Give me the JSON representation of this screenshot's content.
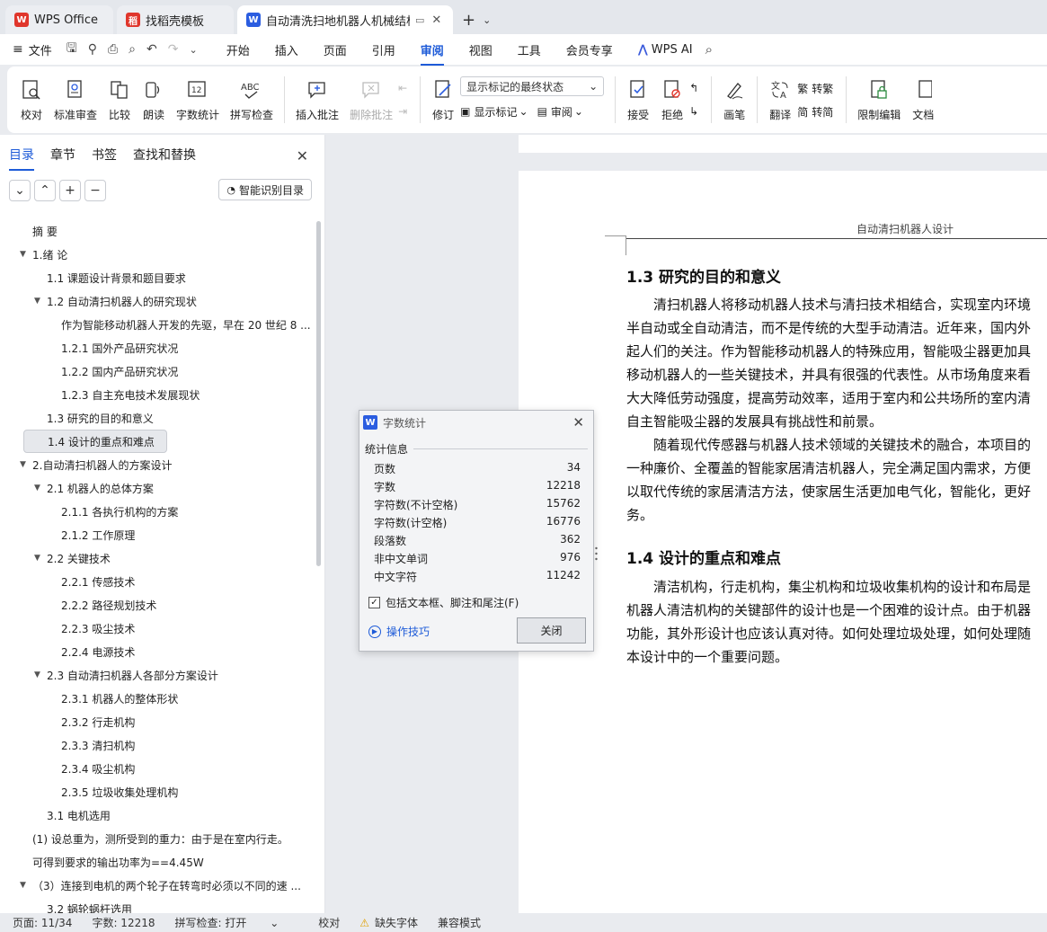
{
  "tabs": [
    {
      "label": "WPS Office",
      "icon": "wps-logo-icon",
      "color": "#e0362c"
    },
    {
      "label": "找稻壳模板",
      "icon": "docer-icon",
      "color": "#e0362c"
    },
    {
      "label": "自动清洗扫地机器人机械结构",
      "icon": "writer-icon",
      "color": "#2b5de0"
    }
  ],
  "menu": {
    "file": "文件",
    "items": [
      "开始",
      "插入",
      "页面",
      "引用",
      "审阅",
      "视图",
      "工具",
      "会员专享"
    ],
    "active": "审阅",
    "ai": "WPS AI"
  },
  "ribbon": {
    "proofread": "校对",
    "std_review": "标准审查",
    "compare": "比较",
    "read_aloud": "朗读",
    "word_count": "字数统计",
    "spell_check": "拼写检查",
    "insert_comment": "插入批注",
    "delete_comment": "删除批注",
    "revise": "修订",
    "show_state": "显示标记的最终状态",
    "show_marks": "显示标记",
    "review": "审阅",
    "accept": "接受",
    "reject": "拒绝",
    "pen": "画笔",
    "translate": "翻译",
    "to_trad": "转繁",
    "to_simp": "转简",
    "restrict": "限制编辑",
    "doc": "文档"
  },
  "nav": {
    "tabs": [
      "目录",
      "章节",
      "书签",
      "查找和替换"
    ],
    "smart": "智能识别目录",
    "toc": [
      {
        "text": "摘    要",
        "level": 1,
        "arrow": false
      },
      {
        "text": "1.绪  论",
        "level": 0,
        "arrow": true
      },
      {
        "text": "1.1   课题设计背景和题目要求",
        "level": 2,
        "arrow": false
      },
      {
        "text": "1.2   自动清扫机器人的研究现状",
        "level": 2,
        "arrow": true
      },
      {
        "text": "作为智能移动机器人开发的先驱，早在 20 世纪 8 ...",
        "level": 3,
        "arrow": false
      },
      {
        "text": "1.2.1   国外产品研究状况",
        "level": 3,
        "arrow": false
      },
      {
        "text": "1.2.2   国内产品研究状况",
        "level": 3,
        "arrow": false
      },
      {
        "text": "1.2.3   自主充电技术发展现状",
        "level": 3,
        "arrow": false
      },
      {
        "text": "1.3   研究的目的和意义",
        "level": 2,
        "arrow": false
      },
      {
        "text": "1.4   设计的重点和难点",
        "level": 2,
        "arrow": false,
        "selected": true
      },
      {
        "text": "2.自动清扫机器人的方案设计",
        "level": 0,
        "arrow": true
      },
      {
        "text": "2.1   机器人的总体方案",
        "level": 2,
        "arrow": true
      },
      {
        "text": "2.1.1   各执行机构的方案",
        "level": 3,
        "arrow": false
      },
      {
        "text": "2.1.2   工作原理",
        "level": 3,
        "arrow": false
      },
      {
        "text": "2.2   关键技术",
        "level": 2,
        "arrow": true
      },
      {
        "text": "2.2.1   传感技术",
        "level": 3,
        "arrow": false
      },
      {
        "text": "2.2.2   路径规划技术",
        "level": 3,
        "arrow": false
      },
      {
        "text": "2.2.3   吸尘技术",
        "level": 3,
        "arrow": false
      },
      {
        "text": "2.2.4   电源技术",
        "level": 3,
        "arrow": false
      },
      {
        "text": "2.3   自动清扫机器人各部分方案设计",
        "level": 2,
        "arrow": true
      },
      {
        "text": "2.3.1   机器人的整体形状",
        "level": 3,
        "arrow": false
      },
      {
        "text": "2.3.2   行走机构",
        "level": 3,
        "arrow": false
      },
      {
        "text": "2.3.3   清扫机构",
        "level": 3,
        "arrow": false
      },
      {
        "text": "2.3.4   吸尘机构",
        "level": 3,
        "arrow": false
      },
      {
        "text": "2.3.5   垃圾收集处理机构",
        "level": 3,
        "arrow": false
      },
      {
        "text": "3.1   电机选用",
        "level": 2,
        "arrow": false
      },
      {
        "text": "(1)  设总重为，测所受到的重力：由于是在室内行走。",
        "level": 1,
        "arrow": false
      },
      {
        "text": "可得到要求的输出功率为==4.45W",
        "level": 1,
        "arrow": false
      },
      {
        "text": "（3）连接到电机的两个轮子在转弯时必须以不同的速 ...",
        "level": 1,
        "arrow": true
      },
      {
        "text": "3.2   蜗轮蜗杆选用",
        "level": 2,
        "arrow": false
      }
    ]
  },
  "document": {
    "header": "自动清扫机器人设计",
    "h13": "1.3   研究的目的和意义",
    "p1": [
      "清扫机器人将移动机器人技术与清扫技术相结合，实现室内环境",
      "半自动或全自动清洁，而不是传统的大型手动清洁。近年来，国内外",
      "起人们的关注。作为智能移动机器人的特殊应用，智能吸尘器更加具",
      "移动机器人的一些关键技术，并具有很强的代表性。从市场角度来看",
      "大大降低劳动强度，提高劳动效率，适用于室内和公共场所的室内清",
      "自主智能吸尘器的发展具有挑战性和前景。"
    ],
    "p2": [
      "随着现代传感器与机器人技术领域的关键技术的融合，本项目的",
      "一种廉价、全覆盖的智能家居清洁机器人，完全满足国内需求，方便",
      "以取代传统的家居清洁方法，使家居生活更加电气化，智能化，更好",
      "务。"
    ],
    "h14": "1.4   设计的重点和难点",
    "p3": [
      "清洁机构，行走机构，集尘机构和垃圾收集机构的设计和布局是",
      "机器人清洁机构的关键部件的设计也是一个困难的设计点。由于机器",
      "功能，其外形设计也应该认真对待。如何处理垃圾处理，如何处理随",
      "本设计中的一个重要问题。"
    ]
  },
  "dialog": {
    "title": "字数统计",
    "group": "统计信息",
    "rows": [
      {
        "label": "页数",
        "value": "34"
      },
      {
        "label": "字数",
        "value": "12218"
      },
      {
        "label": "字符数(不计空格)",
        "value": "15762"
      },
      {
        "label": "字符数(计空格)",
        "value": "16776"
      },
      {
        "label": "段落数",
        "value": "362"
      },
      {
        "label": "非中文单词",
        "value": "976"
      },
      {
        "label": "中文字符",
        "value": "11242"
      }
    ],
    "checkbox": "包括文本框、脚注和尾注(F)",
    "checked": true,
    "tips": "操作技巧",
    "close": "关闭"
  },
  "status": {
    "page": "页面: 11/34",
    "words": "字数: 12218",
    "spell": "拼写检查: 打开",
    "proof": "校对",
    "missing_font": "缺失字体",
    "compat": "兼容模式"
  }
}
